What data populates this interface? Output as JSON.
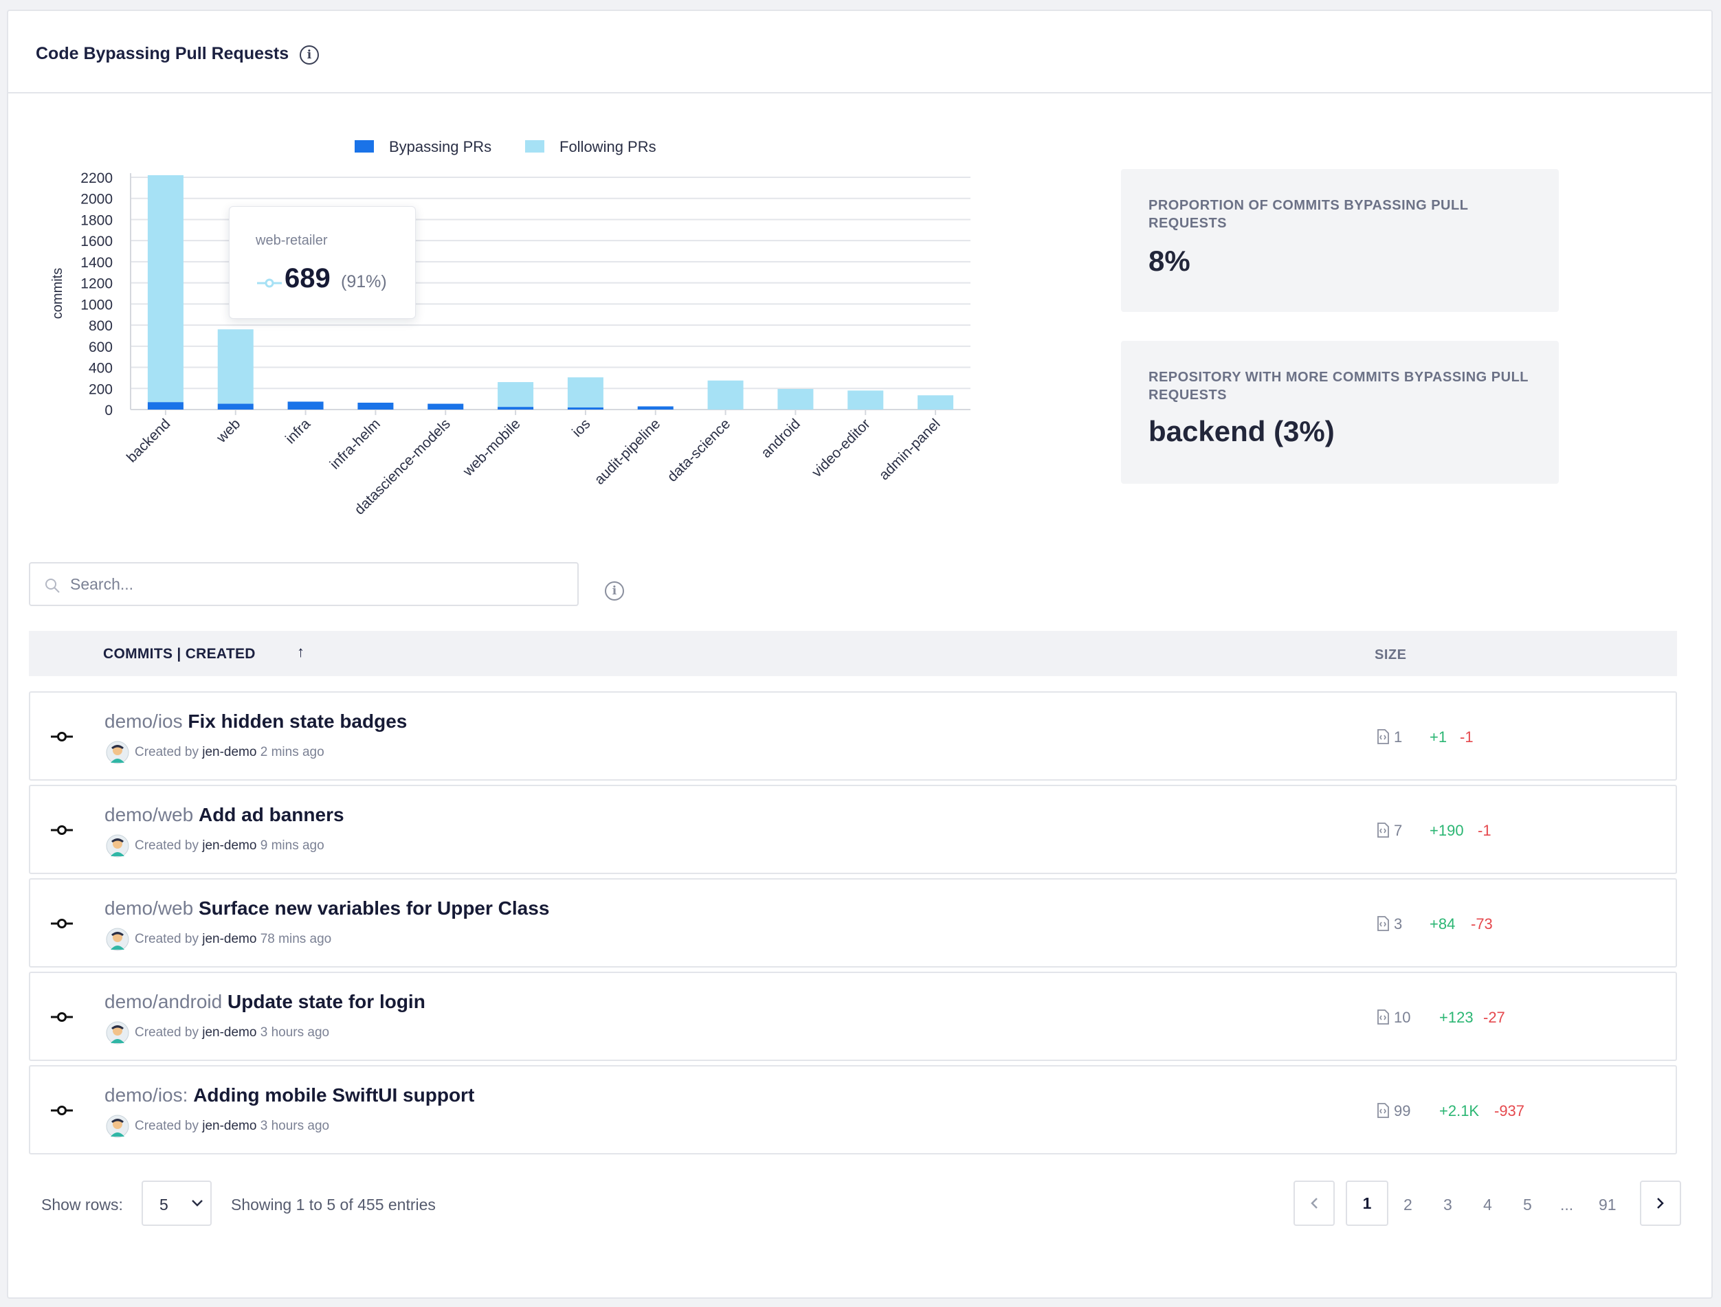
{
  "header": {
    "title": "Code Bypassing Pull Requests"
  },
  "colors": {
    "bypassing": "#1a73e8",
    "following": "#a6e1f5",
    "added": "#2bb673",
    "removed": "#e5484d"
  },
  "chart_data": {
    "type": "bar",
    "stacked": true,
    "ylabel": "commits",
    "ylim": [
      0,
      2200
    ],
    "yticks": [
      0,
      200,
      400,
      600,
      800,
      1000,
      1200,
      1400,
      1600,
      1800,
      2000,
      2200
    ],
    "grid": true,
    "legend_position": "top",
    "categories": [
      "backend",
      "web",
      "infra",
      "infra-helm",
      "datascience-models",
      "web-mobile",
      "ios",
      "audit-pipeline",
      "data-science",
      "android",
      "video-editor",
      "admin-panel"
    ],
    "series": [
      {
        "name": "Bypassing PRs",
        "values": [
          70,
          55,
          75,
          65,
          55,
          25,
          20,
          30,
          0,
          0,
          0,
          0
        ]
      },
      {
        "name": "Following PRs",
        "values": [
          2150,
          705,
          0,
          0,
          0,
          235,
          285,
          0,
          275,
          195,
          180,
          135
        ]
      }
    ],
    "tooltip": {
      "repo": "web-retailer",
      "value": "689",
      "pct": "(91%)"
    }
  },
  "stats": [
    {
      "label": "PROPORTION OF COMMITS BYPASSING PULL REQUESTS",
      "value": "8%"
    },
    {
      "label": "REPOSITORY WITH MORE COMMITS BYPASSING PULL REQUESTS",
      "value": "backend (3%)"
    }
  ],
  "search": {
    "placeholder": "Search...",
    "value": ""
  },
  "table": {
    "col_commits": "COMMITS | CREATED",
    "col_size": "SIZE",
    "rows": [
      {
        "repo": "demo/ios",
        "message": "Fix hidden state badges",
        "created_by": "Created by",
        "author": "jen-demo",
        "time": "2 mins ago",
        "files": "1",
        "added": "+1",
        "removed": "-1"
      },
      {
        "repo": "demo/web",
        "message": "Add ad banners",
        "created_by": "Created by",
        "author": "jen-demo",
        "time": "9 mins ago",
        "files": "7",
        "added": "+190",
        "removed": "-1"
      },
      {
        "repo": "demo/web",
        "message": "Surface new variables for Upper Class",
        "created_by": "Created by",
        "author": "jen-demo",
        "time": "78 mins ago",
        "files": "3",
        "added": "+84",
        "removed": "-73"
      },
      {
        "repo": "demo/android",
        "message": "Update state for login",
        "created_by": "Created by",
        "author": "jen-demo",
        "time": "3 hours ago",
        "files": "10",
        "added": "+123",
        "removed": "-27"
      },
      {
        "repo": "demo/ios:",
        "message": "Adding mobile SwiftUI support",
        "created_by": "Created by",
        "author": "jen-demo",
        "time": "3 hours ago",
        "files": "99",
        "added": "+2.1K",
        "removed": "-937"
      }
    ]
  },
  "pagination": {
    "show_rows_label": "Show rows:",
    "rows_per_page": "5",
    "showing": "Showing 1 to 5 of 455 entries",
    "current": "1",
    "pages": [
      "2",
      "3",
      "4",
      "5",
      "...",
      "91"
    ]
  }
}
